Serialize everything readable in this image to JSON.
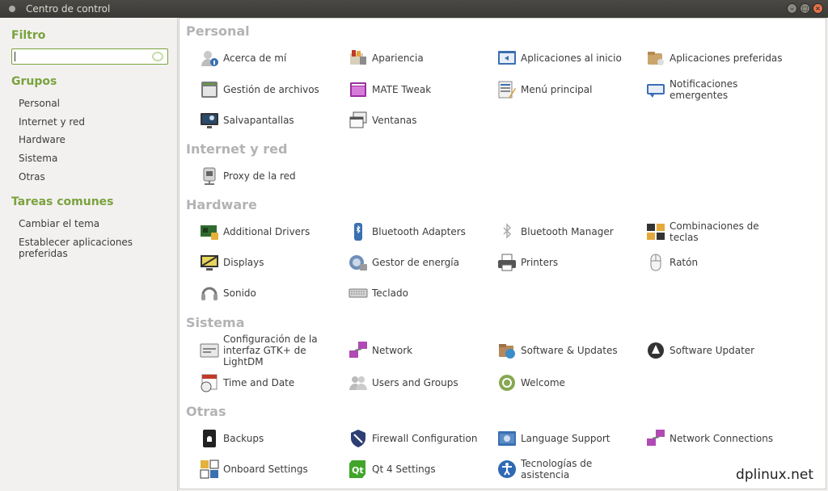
{
  "window": {
    "title": "Centro de control"
  },
  "sidebar": {
    "filter_heading": "Filtro",
    "search_value": "",
    "groups_heading": "Grupos",
    "groups": [
      "Personal",
      "Internet y red",
      "Hardware",
      "Sistema",
      "Otras"
    ],
    "tasks_heading": "Tareas comunes",
    "tasks": [
      "Cambiar el tema",
      "Establecer aplicaciones preferidas"
    ]
  },
  "categories": [
    {
      "title": "Personal",
      "apps": [
        {
          "label": "Acerca de mí",
          "icon": "user-info-icon"
        },
        {
          "label": "Apariencia",
          "icon": "appearance-icon"
        },
        {
          "label": "Aplicaciones al inicio",
          "icon": "startup-apps-icon"
        },
        {
          "label": "Aplicaciones preferidas",
          "icon": "preferred-apps-icon"
        },
        {
          "label": "Gestión de archivos",
          "icon": "file-management-icon"
        },
        {
          "label": "MATE Tweak",
          "icon": "mate-tweak-icon"
        },
        {
          "label": "Menú principal",
          "icon": "main-menu-icon"
        },
        {
          "label": "Notificaciones emergentes",
          "icon": "notifications-icon"
        },
        {
          "label": "Salvapantallas",
          "icon": "screensaver-icon"
        },
        {
          "label": "Ventanas",
          "icon": "windows-icon"
        }
      ]
    },
    {
      "title": "Internet y red",
      "apps": [
        {
          "label": "Proxy de la red",
          "icon": "network-proxy-icon"
        }
      ]
    },
    {
      "title": "Hardware",
      "apps": [
        {
          "label": "Additional Drivers",
          "icon": "drivers-icon"
        },
        {
          "label": "Bluetooth Adapters",
          "icon": "bluetooth-adapter-icon"
        },
        {
          "label": "Bluetooth Manager",
          "icon": "bluetooth-icon"
        },
        {
          "label": "Combinaciones de teclas",
          "icon": "keyboard-shortcuts-icon"
        },
        {
          "label": "Displays",
          "icon": "display-icon"
        },
        {
          "label": "Gestor de energía",
          "icon": "power-manager-icon"
        },
        {
          "label": "Printers",
          "icon": "printer-icon"
        },
        {
          "label": "Ratón",
          "icon": "mouse-icon"
        },
        {
          "label": "Sonido",
          "icon": "sound-icon"
        },
        {
          "label": "Teclado",
          "icon": "keyboard-icon"
        }
      ]
    },
    {
      "title": "Sistema",
      "apps": [
        {
          "label": "Configuración de la interfaz GTK+ de LightDM",
          "icon": "lightdm-icon"
        },
        {
          "label": "Network",
          "icon": "network-icon"
        },
        {
          "label": "Software & Updates",
          "icon": "software-updates-icon"
        },
        {
          "label": "Software Updater",
          "icon": "software-updater-icon"
        },
        {
          "label": "Time and Date",
          "icon": "calendar-clock-icon"
        },
        {
          "label": "Users and Groups",
          "icon": "users-icon"
        },
        {
          "label": "Welcome",
          "icon": "welcome-icon"
        }
      ]
    },
    {
      "title": "Otras",
      "apps": [
        {
          "label": "Backups",
          "icon": "backups-icon"
        },
        {
          "label": "Firewall Configuration",
          "icon": "firewall-icon"
        },
        {
          "label": "Language Support",
          "icon": "language-icon"
        },
        {
          "label": "Network Connections",
          "icon": "network-connections-icon"
        },
        {
          "label": "Onboard Settings",
          "icon": "onboard-icon"
        },
        {
          "label": "Qt 4 Settings",
          "icon": "qt-icon"
        },
        {
          "label": "Tecnologías de asistencia",
          "icon": "accessibility-icon"
        }
      ]
    }
  ],
  "watermark": "dplinux.net"
}
